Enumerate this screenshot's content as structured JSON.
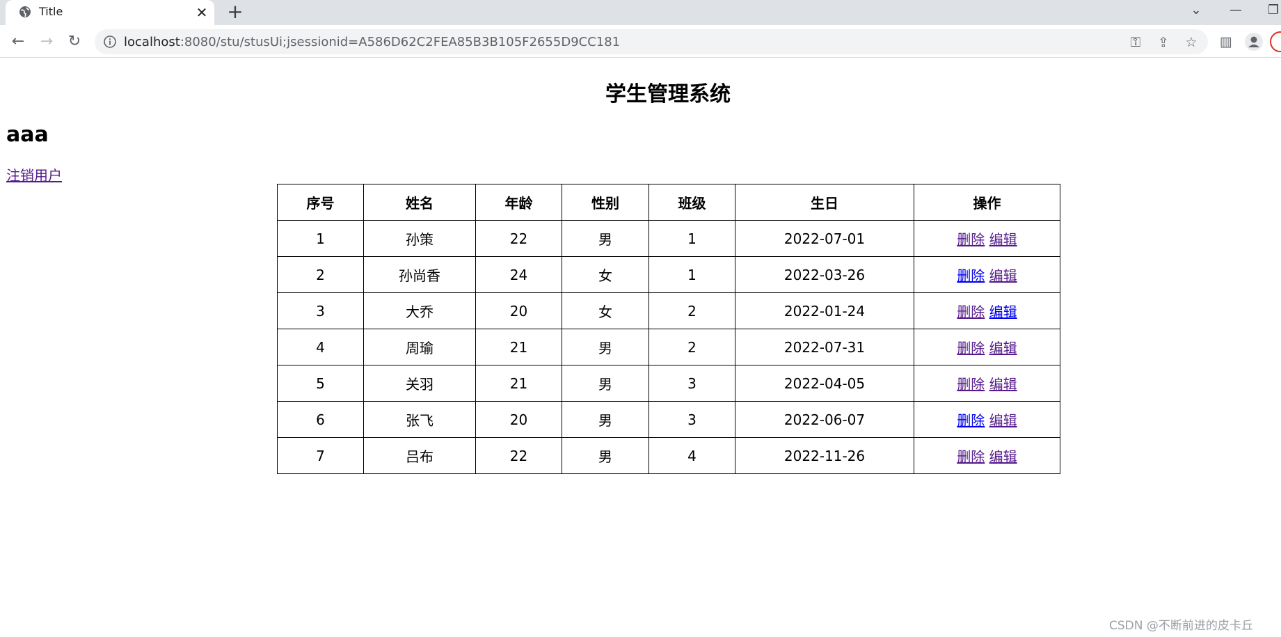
{
  "browser": {
    "tab_title": "Title",
    "tab_close": "✕",
    "new_tab": "+",
    "url_host": "localhost",
    "url_rest": ":8080/stu/stusUi;jsessionid=A586D62C2FEA85B3B105F2655D9CC181",
    "nav": {
      "back": "←",
      "forward": "→",
      "reload": "↻"
    },
    "icons": {
      "key": "⚿",
      "share": "⇪",
      "star": "☆",
      "sidepanel": "▥",
      "tab_list": "⌄",
      "minimize": "—",
      "restore": "❐"
    }
  },
  "page": {
    "title": "学生管理系统",
    "username": "aaa",
    "logout_label": "注销用户"
  },
  "table": {
    "headers": [
      "序号",
      "姓名",
      "年龄",
      "性别",
      "班级",
      "生日",
      "操作"
    ],
    "rows": [
      [
        "1",
        "孙策",
        "22",
        "男",
        "1",
        "2022-07-01"
      ],
      [
        "2",
        "孙尚香",
        "24",
        "女",
        "1",
        "2022-03-26"
      ],
      [
        "3",
        "大乔",
        "20",
        "女",
        "2",
        "2022-01-24"
      ],
      [
        "4",
        "周瑜",
        "21",
        "男",
        "2",
        "2022-07-31"
      ],
      [
        "5",
        "关羽",
        "21",
        "男",
        "3",
        "2022-04-05"
      ],
      [
        "6",
        "张飞",
        "20",
        "男",
        "3",
        "2022-06-07"
      ],
      [
        "7",
        "吕布",
        "22",
        "男",
        "4",
        "2022-11-26"
      ]
    ],
    "delete_label": "删除",
    "edit_label": "编辑"
  },
  "watermark": "CSDN @不断前进的皮卡丘",
  "colors": {
    "link": "#0000ee",
    "visited_link": "#551a8b",
    "chrome_bg": "#dee1e6"
  }
}
